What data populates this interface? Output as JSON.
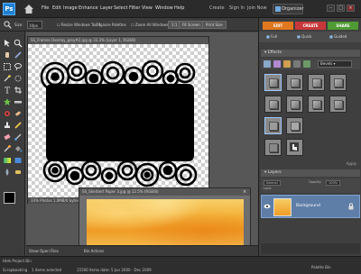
{
  "menubar": {
    "logo": "Ps",
    "menus": [
      "File",
      "Edit",
      "Image",
      "Enhance",
      "Layer",
      "Select",
      "Filter",
      "View",
      "Window",
      "Help"
    ],
    "account": [
      "Create",
      "Sign In",
      "Join Now"
    ],
    "organizer_label": "Organizer"
  },
  "options": {
    "size_label": "Size:",
    "size_value": "10px",
    "resize_windows": "Resize Windows To Fit",
    "ignore_palettes": "Ignore Palettes",
    "zoom_all": "Zoom All Windows",
    "actual_pixels": "1:1",
    "fit_screen": "Fit Screen",
    "print_size": "Print Size"
  },
  "doc1": {
    "title": "SS_Frames Overlay_grey#2.jpg @ 33.3% (Layer 1, RGB/8)",
    "zoom": "33%",
    "status": "33% Photos 1.0MB/0 bytes"
  },
  "doc2": {
    "title": "SS_Sherbert Paper 3.jpg @ 12.5% (RGB/8)"
  },
  "bin": {
    "show_open_files": "Show Open Files",
    "bin_actions": "Bin Actions",
    "hide_project_bin": "Hide Project Bin"
  },
  "status": {
    "text1": "Scrapbooking",
    "text2": "1 items selected",
    "text3": "15500 items date: 5 Jun 2000 - Dec 2009"
  },
  "panel": {
    "tab_edit": "EDIT",
    "tab_create": "CREATE",
    "tab_share": "SHARE",
    "subtab_full": "Full",
    "subtab_quick": "Quick",
    "subtab_guided": "Guided",
    "effects_label": "Effects",
    "effects_filter": "Bevels",
    "apply": "Apply",
    "layers_label": "Layers",
    "blend_mode": "Normal",
    "opacity_label": "Opacity:",
    "opacity_value": "100%",
    "lock_label": "Lock:",
    "layer_name": "Background",
    "palette_bin": "Palette Bin"
  },
  "colors": {
    "edit_tab": "#e07820",
    "create_tab": "#c8383a",
    "share_tab": "#4f9a34",
    "accent": "#5e7ea8"
  }
}
